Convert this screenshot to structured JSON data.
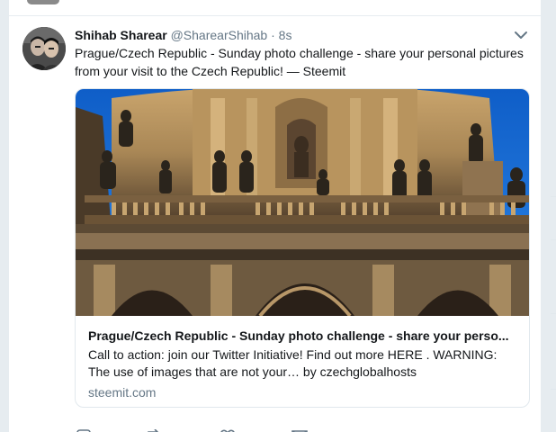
{
  "tweet": {
    "fullname": "Shihab Sharear",
    "handle": "@SharearShihab",
    "separator": "·",
    "time": "8s",
    "text": "Prague/Czech Republic - Sunday photo challenge - share your personal pictures from your visit to the Czech Republic! — Steemit"
  },
  "card": {
    "title": "Prague/Czech Republic - Sunday photo challenge - share your perso...",
    "description": "Call to action: join our Twitter Initiative! Find out more HERE . WARNING: The use of images that are not your… by czechglobalhosts",
    "domain": "steemit.com",
    "image_subject": "baroque church facade with statues against blue sky"
  },
  "icons": {
    "menu": "chevron-down-icon",
    "reply": "reply-icon",
    "retweet": "retweet-icon",
    "like": "heart-icon",
    "message": "envelope-icon"
  },
  "colors": {
    "background": "#e6ecf0",
    "text": "#14171a",
    "secondary_text": "#657786",
    "border": "#e1e8ed",
    "sky": "#1e6fd0"
  }
}
